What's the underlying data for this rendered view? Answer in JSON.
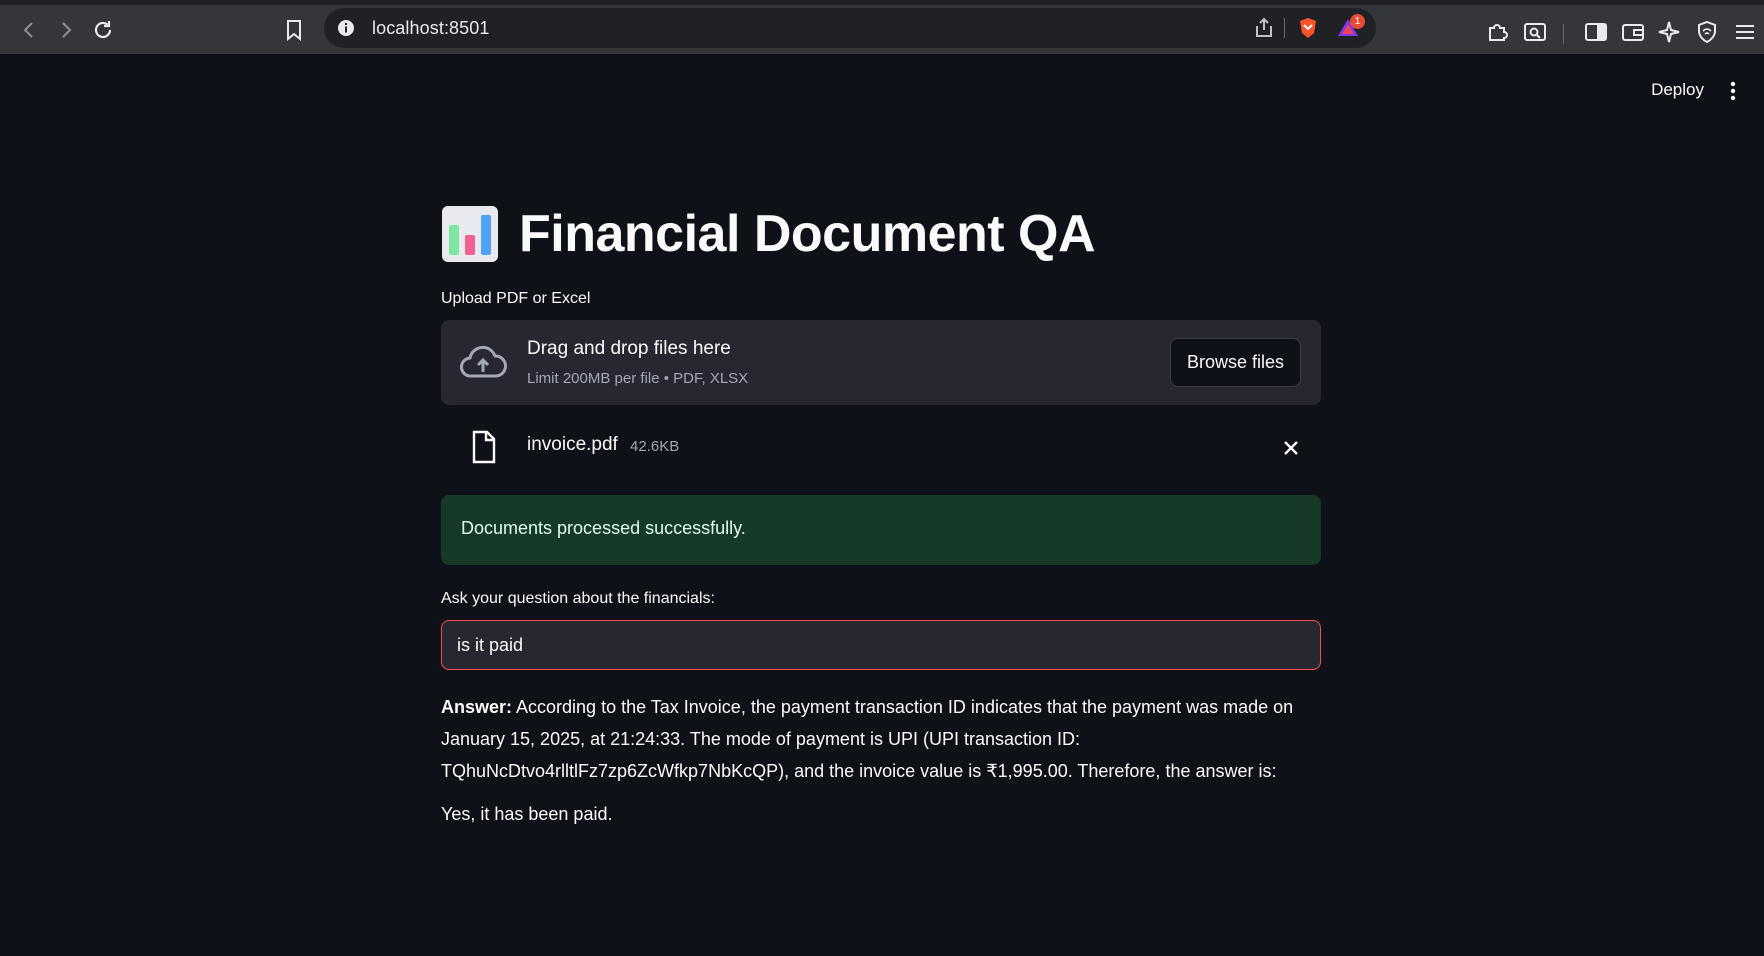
{
  "browser": {
    "url": "localhost:8501",
    "badge_count": "1"
  },
  "header": {
    "deploy_label": "Deploy"
  },
  "page": {
    "title": "Financial Document QA",
    "title_icon": "bar-chart-emoji"
  },
  "uploader": {
    "label": "Upload PDF or Excel",
    "drop_text": "Drag and drop files here",
    "limit_text": "Limit 200MB per file • PDF, XLSX",
    "browse_label": "Browse files",
    "file": {
      "name": "invoice.pdf",
      "size": "42.6KB"
    }
  },
  "status": {
    "message": "Documents processed successfully.",
    "color": "#173928"
  },
  "question": {
    "label": "Ask your question about the financials:",
    "value": "is it paid",
    "border_color": "#ff4b4b"
  },
  "answer": {
    "prefix": "Answer:",
    "body": " According to the Tax Invoice, the payment transaction ID indicates that the payment was made on January 15, 2025, at 21:24:33. The mode of payment is UPI (UPI transaction ID: TQhuNcDtvo4rlltlFz7zp6ZcWfkp7NbKcQP), and the invoice value is ₹1,995.00. Therefore, the answer is:",
    "conclusion": "Yes, it has been paid."
  }
}
